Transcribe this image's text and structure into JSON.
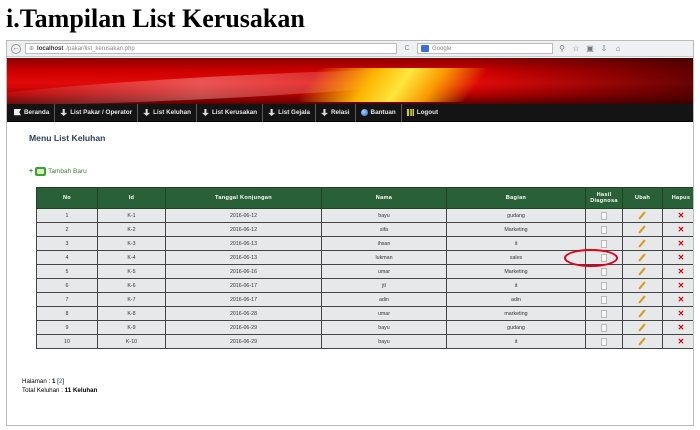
{
  "document": {
    "heading": "i.Tampilan List Kerusakan"
  },
  "browser": {
    "back": "←",
    "url_host": "localhost",
    "url_path": "/pakar/list_kerusakan.php",
    "reload": "C",
    "search_placeholder": "Google"
  },
  "menu": {
    "items": [
      {
        "label": "Beranda",
        "icon": "flag-icon"
      },
      {
        "label": "List Pakar / Operator",
        "icon": "pin-icon"
      },
      {
        "label": "List Keluhan",
        "icon": "pin-icon"
      },
      {
        "label": "List Kerusakan",
        "icon": "pin-icon"
      },
      {
        "label": "List Gejala",
        "icon": "pin-icon"
      },
      {
        "label": "Relasi",
        "icon": "pin-icon"
      },
      {
        "label": "Bantuan",
        "icon": "globe-icon"
      },
      {
        "label": "Logout",
        "icon": "chart-icon"
      }
    ]
  },
  "main": {
    "title": "Menu List Keluhan",
    "add_label": "Tambah Baru",
    "table": {
      "columns": [
        "No",
        "Id",
        "Tanggal Konjungan",
        "Nama",
        "Bagian",
        "Hasil Diagnosa",
        "Ubah",
        "Hapus"
      ],
      "rows": [
        {
          "no": "1",
          "id": "K-1",
          "tanggal": "2016-06-12",
          "nama": "bayu",
          "bagian": "gudang"
        },
        {
          "no": "2",
          "id": "K-2",
          "tanggal": "2016-06-12",
          "nama": "sifa",
          "bagian": "Marketing"
        },
        {
          "no": "3",
          "id": "K-3",
          "tanggal": "2016-06-13",
          "nama": "ihsan",
          "bagian": "it"
        },
        {
          "no": "4",
          "id": "K-4",
          "tanggal": "2016-06-13",
          "nama": "lukman",
          "bagian": "sales"
        },
        {
          "no": "5",
          "id": "K-5",
          "tanggal": "2016-06-16",
          "nama": "umar",
          "bagian": "Marketing"
        },
        {
          "no": "6",
          "id": "K-6",
          "tanggal": "2016-06-17",
          "nama": "jtl",
          "bagian": "it"
        },
        {
          "no": "7",
          "id": "K-7",
          "tanggal": "2016-06-17",
          "nama": "adin",
          "bagian": "adin"
        },
        {
          "no": "8",
          "id": "K-8",
          "tanggal": "2016-06-28",
          "nama": "umar",
          "bagian": "marketing"
        },
        {
          "no": "9",
          "id": "K-9",
          "tanggal": "2016-06-29",
          "nama": "bayu",
          "bagian": "gudang"
        },
        {
          "no": "10",
          "id": "K-10",
          "tanggal": "2016-06-29",
          "nama": "bayu",
          "bagian": "it"
        }
      ]
    }
  },
  "footer": {
    "halaman_label": "Halaman :",
    "current_page": "1",
    "bracket_open": "[",
    "page_2": "2",
    "bracket_close": "]",
    "total_label": "Total Keluhan :",
    "total_value": "11",
    "total_unit": "Keluhan"
  },
  "colors": {
    "banner_red": "#d10000",
    "menu_bg": "#141414",
    "table_header": "#2a6037",
    "highlight": "#e0001a"
  }
}
